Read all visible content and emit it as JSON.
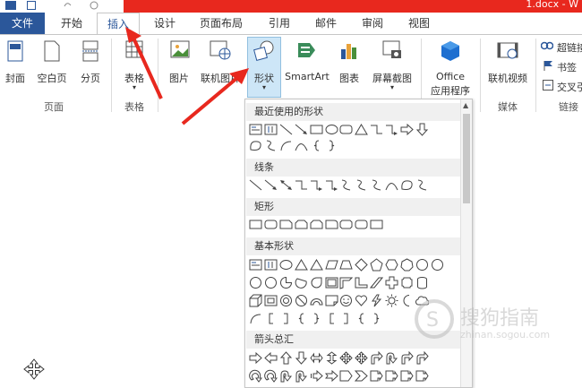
{
  "window": {
    "doc_title": "1.docx - W"
  },
  "tabs": [
    {
      "label": "文件"
    },
    {
      "label": "开始"
    },
    {
      "label": "插入"
    },
    {
      "label": "设计"
    },
    {
      "label": "页面布局"
    },
    {
      "label": "引用"
    },
    {
      "label": "邮件"
    },
    {
      "label": "审阅"
    },
    {
      "label": "视图"
    }
  ],
  "ribbon": {
    "pages_group": {
      "label": "页面",
      "buttons": [
        "封面",
        "空白页",
        "分页"
      ]
    },
    "tables_group": {
      "label": "表格",
      "buttons": [
        "表格"
      ]
    },
    "illustrations": {
      "buttons": [
        "图片",
        "联机图片",
        "形状",
        "SmartArt",
        "图表",
        "屏幕截图"
      ]
    },
    "apps": {
      "line1": "Office",
      "line2": "应用程序"
    },
    "media_group": {
      "label": "媒体",
      "buttons": [
        "联机视频"
      ]
    },
    "links_group": {
      "label": "链接",
      "buttons": [
        "超链接",
        "书签",
        "交叉引用"
      ]
    },
    "accent_color": "#2b579a",
    "title_bar_color": "#e8281e"
  },
  "shapes_gallery": {
    "sections": [
      {
        "title": "最近使用的形状"
      },
      {
        "title": "线条"
      },
      {
        "title": "矩形"
      },
      {
        "title": "基本形状"
      },
      {
        "title": "箭头总汇"
      }
    ]
  },
  "watermark": {
    "text_cn": "搜狗指南",
    "text_en": "zhinan.sogou.com"
  }
}
